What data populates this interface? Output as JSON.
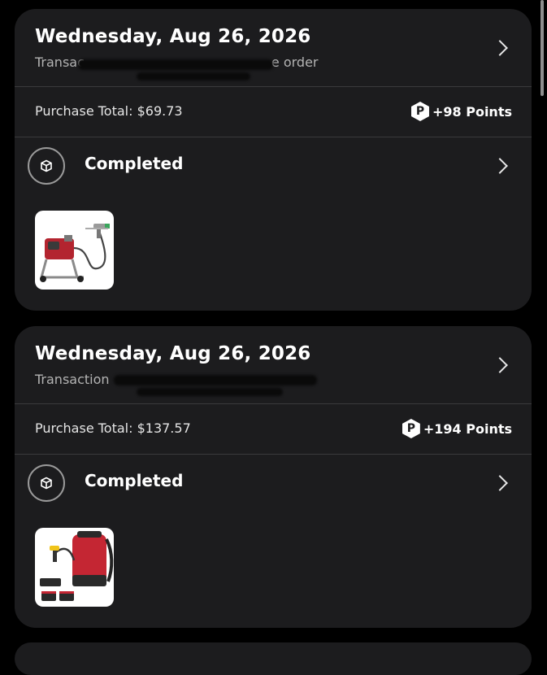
{
  "orders": [
    {
      "date": "Wednesday, Aug 26, 2026",
      "transaction_prefix": "Transac",
      "transaction_suffix": "e order",
      "purchase_total": "Purchase Total: $69.73",
      "points_badge": "P",
      "points": "+98 Points",
      "status": "Completed",
      "status_icon": "package-icon",
      "product_image": "paint-sprayer-image"
    },
    {
      "date": "Wednesday, Aug 26, 2026",
      "transaction_prefix": "Transaction",
      "transaction_suffix": "",
      "purchase_total": "Purchase Total: $137.57",
      "points_badge": "P",
      "points": "+194 Points",
      "status": "Completed",
      "status_icon": "package-icon",
      "product_image": "backpack-sprayer-image"
    }
  ],
  "colors": {
    "background": "#000000",
    "card": "#1c1c1e",
    "divider": "#3a3a3c",
    "text": "#ffffff",
    "muted": "#b3b3b3"
  }
}
